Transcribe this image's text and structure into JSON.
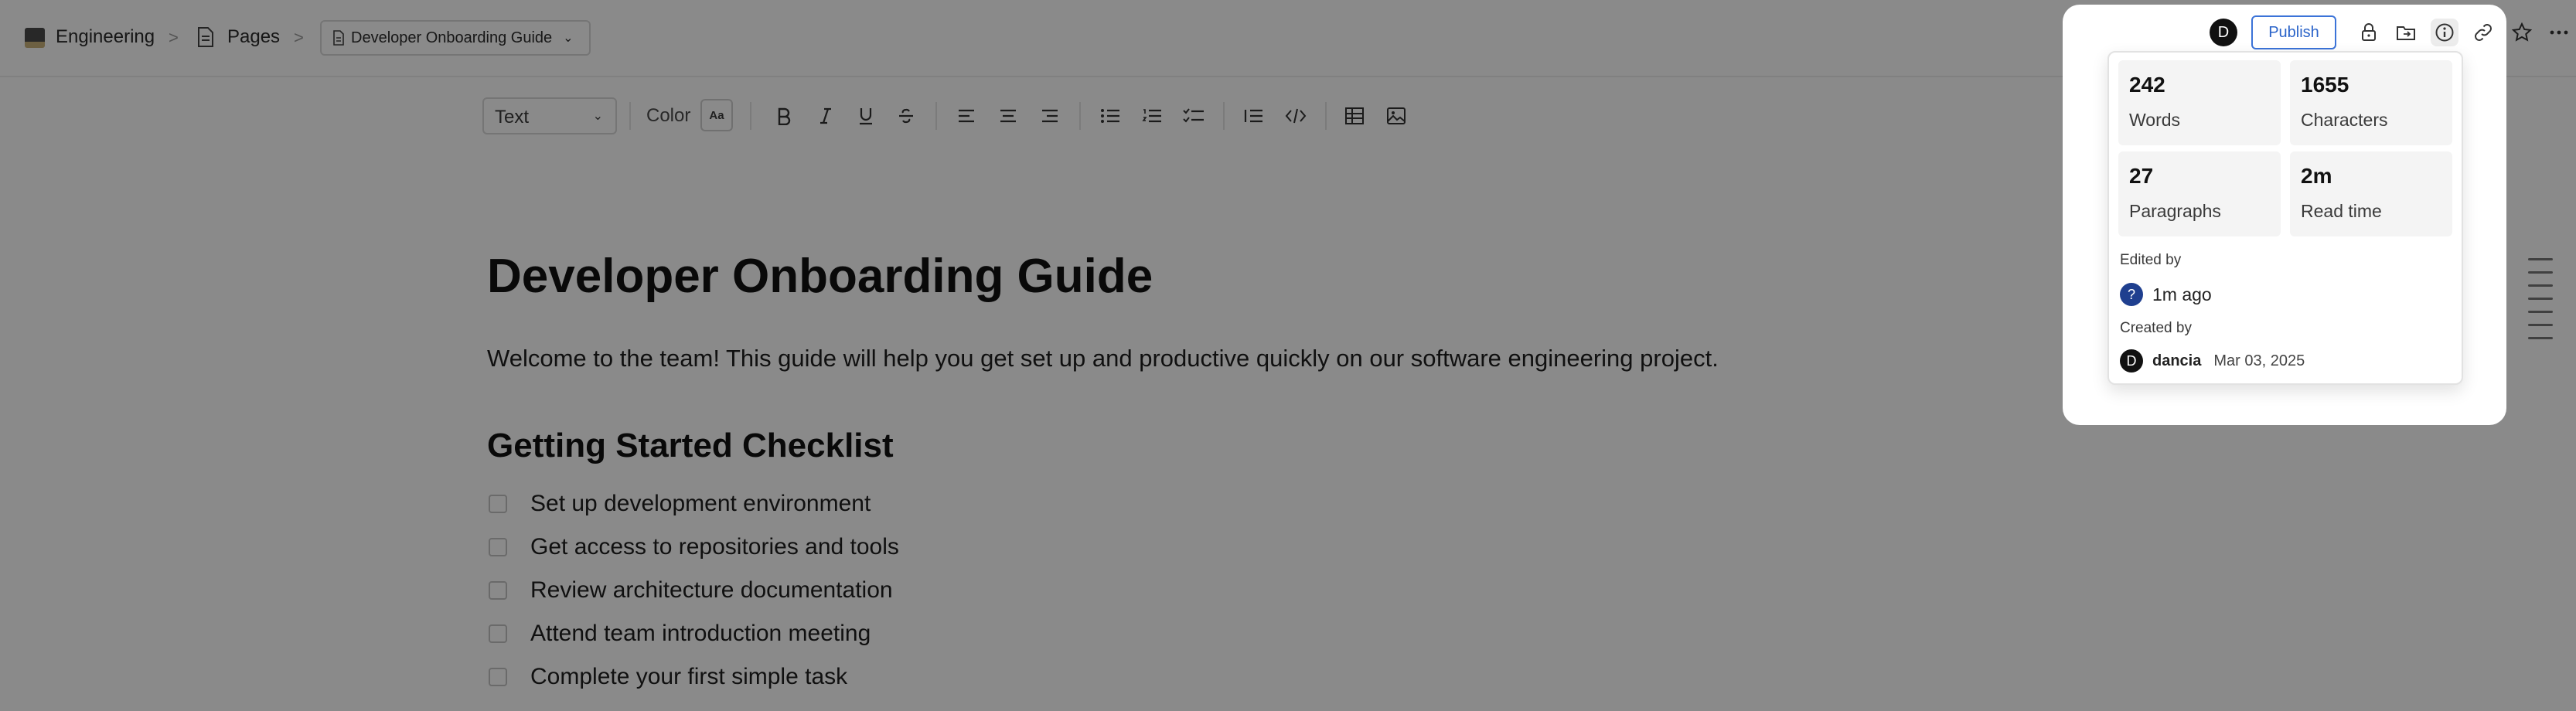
{
  "header": {
    "workspace_name": "Engineering",
    "pages_label": "Pages",
    "current_doc": "Developer Onboarding Guide",
    "separator": ">"
  },
  "toolbar": {
    "block_type": "Text",
    "color_label": "Color",
    "color_swatch": "Aa"
  },
  "document": {
    "title": "Developer Onboarding Guide",
    "intro": "Welcome to the team! This guide will help you get set up and productive quickly on our software engineering project.",
    "section_heading": "Getting Started Checklist",
    "checklist": [
      "Set up development environment",
      "Get access to repositories and tools",
      "Review architecture documentation",
      "Attend team introduction meeting",
      "Complete your first simple task"
    ]
  },
  "topbar": {
    "avatar_initial": "D",
    "publish_label": "Publish"
  },
  "info_popover": {
    "stats": [
      {
        "value": "242",
        "label": "Words"
      },
      {
        "value": "1655",
        "label": "Characters"
      },
      {
        "value": "27",
        "label": "Paragraphs"
      },
      {
        "value": "2m",
        "label": "Read time"
      }
    ],
    "edited_by_label": "Edited by",
    "edited_by_avatar": "?",
    "edited_time": "1m ago",
    "created_by_label": "Created by",
    "creator_avatar": "D",
    "creator_name": "dancia",
    "created_date": "Mar 03, 2025"
  }
}
